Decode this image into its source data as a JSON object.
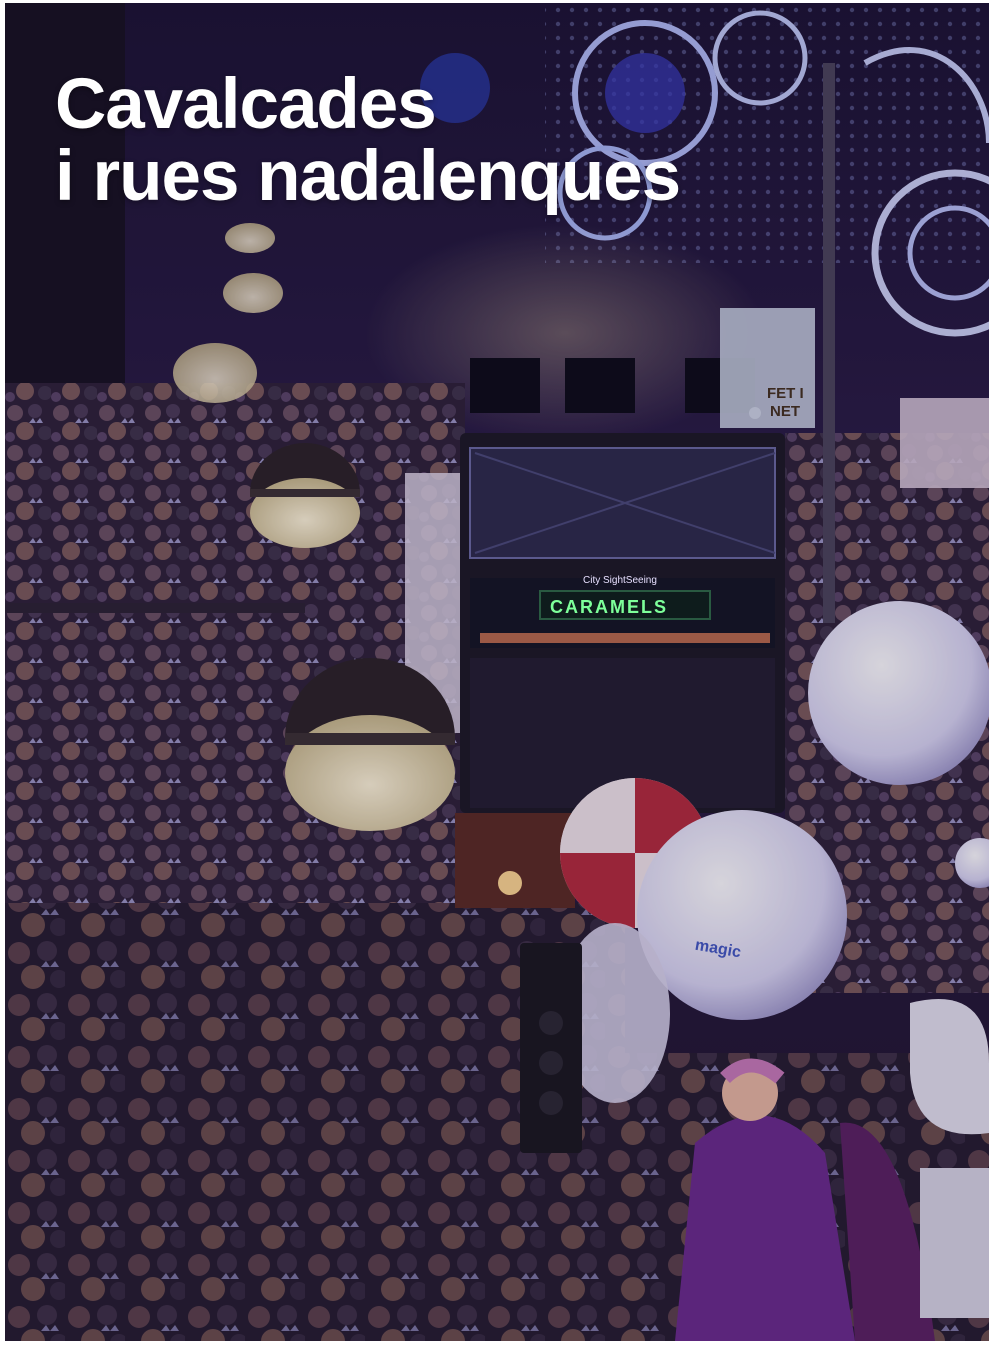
{
  "header": {
    "title_line1": "Cavalcades",
    "title_line2": "i rues nadalenques"
  },
  "scene": {
    "bus_display": "CARAMELS",
    "bus_brand": "City SightSeeing",
    "balloon_brand": "magic",
    "store_sign_line1": "FET I",
    "store_sign_line2": "NET"
  },
  "colors": {
    "overlay": "#1a0f35",
    "lights": "#8fa8ff",
    "display": "#7dff9a"
  }
}
